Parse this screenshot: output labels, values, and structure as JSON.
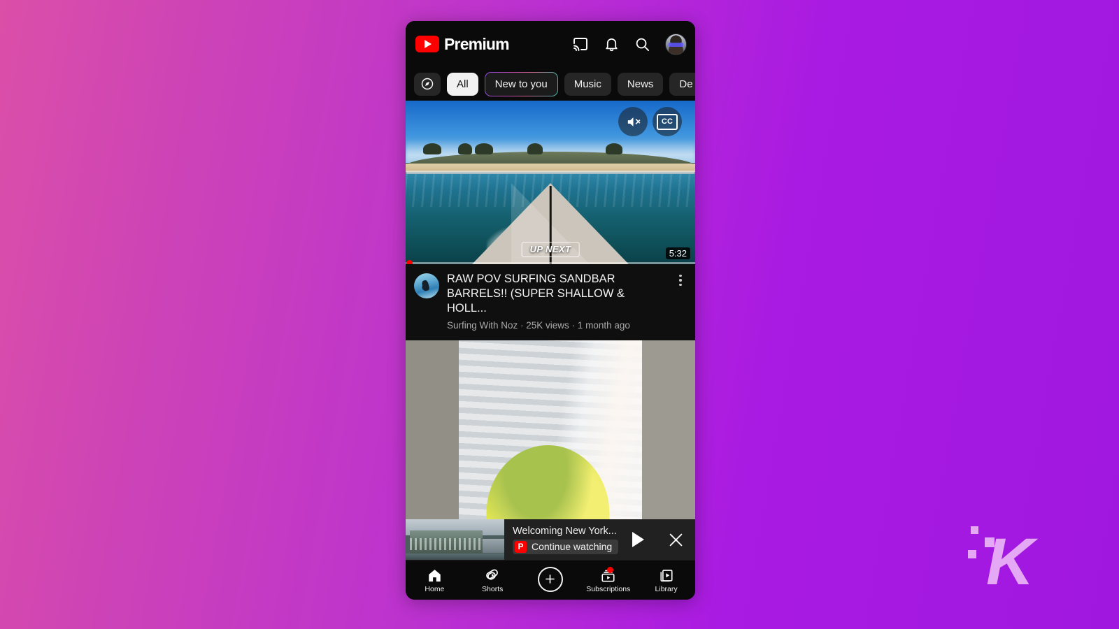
{
  "background": {
    "gradient_from": "#db4fa8",
    "gradient_to": "#a018e0"
  },
  "watermark": {
    "letter": "K"
  },
  "appbar": {
    "brand_wordmark": "Premium",
    "icons": {
      "cast": "cast-icon",
      "notifications": "bell-icon",
      "search": "search-icon",
      "account": "avatar"
    }
  },
  "chips": {
    "explore_icon": "compass-icon",
    "items": [
      {
        "label": "All",
        "state": "active"
      },
      {
        "label": "New to you",
        "state": "gradient"
      },
      {
        "label": "Music",
        "state": "default"
      },
      {
        "label": "News",
        "state": "default"
      },
      {
        "label": "De",
        "state": "truncated"
      }
    ]
  },
  "feed": {
    "video1": {
      "title": "RAW POV SURFING SANDBAR BARRELS!! (SUPER SHALLOW & HOLL...",
      "channel": "Surfing With Noz",
      "views": "25K views",
      "age": "1 month ago",
      "meta_line": "Surfing With Noz · 25K views · 1 month ago",
      "duration": "5:32",
      "up_next_badge": "UP NEXT",
      "overlay_mute_icon": "volume-muted-icon",
      "overlay_cc_icon": "closed-caption-icon",
      "cc_label": "CC",
      "menu_icon": "kebab-menu-icon"
    },
    "video2": {
      "description": "budgie-video-thumbnail"
    }
  },
  "miniplayer": {
    "title": "Welcoming New York...",
    "cta_label": "Continue watching",
    "premium_badge": "P",
    "play_icon": "play-icon",
    "close_icon": "close-icon"
  },
  "bottomnav": {
    "items": [
      {
        "label": "Home",
        "icon": "home-icon",
        "badge": false
      },
      {
        "label": "Shorts",
        "icon": "shorts-icon",
        "badge": false
      },
      {
        "label": "",
        "icon": "plus-create-icon",
        "badge": false
      },
      {
        "label": "Subscriptions",
        "icon": "subscriptions-icon",
        "badge": true
      },
      {
        "label": "Library",
        "icon": "library-icon",
        "badge": false
      }
    ]
  }
}
